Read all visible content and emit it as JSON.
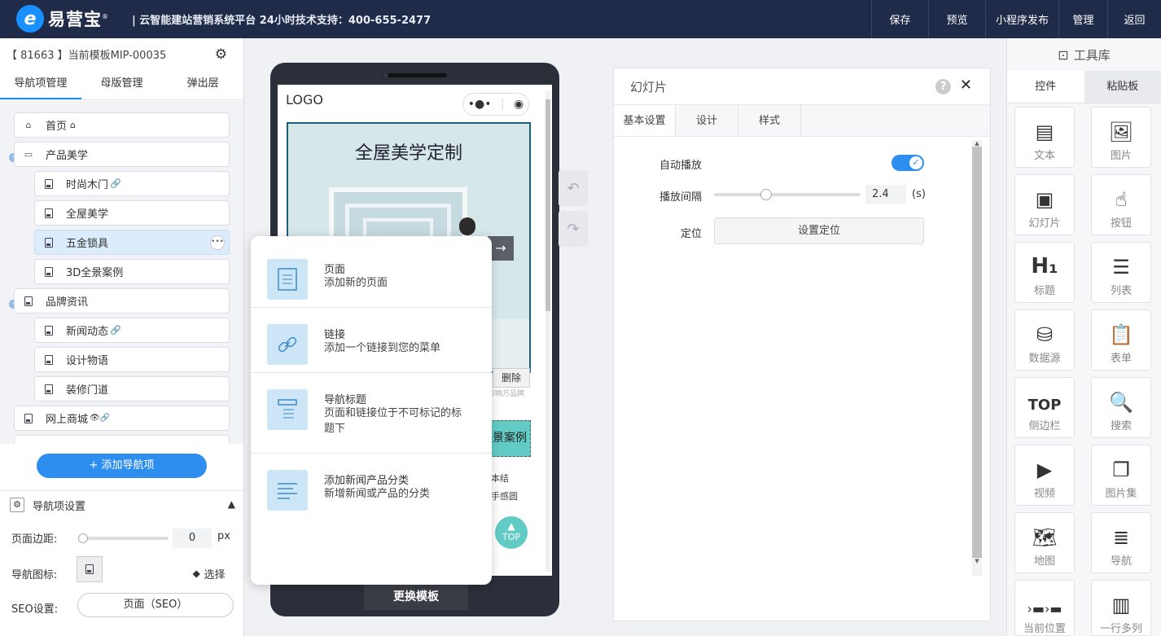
{
  "topbar": {
    "logo_mark": "e",
    "logo_text": "易营宝",
    "logo_reg": "®",
    "slogan": "| 云智能建站营销系统平台 24小时技术支持：400-655-2477",
    "nav": [
      "保存",
      "预览",
      "小程序发布",
      "管理",
      "返回"
    ]
  },
  "left": {
    "template_info": "【 81663 】当前模板MIP-00035",
    "tabs": [
      "导航项管理",
      "母版管理",
      "弹出层"
    ],
    "tree": [
      {
        "label": "首页",
        "suffix": "⌂",
        "level": 0
      },
      {
        "label": "产品美学",
        "suffix": "",
        "level": 0
      },
      {
        "label": "时尚木门",
        "suffix": "🔗",
        "level": 1
      },
      {
        "label": "全屋美学",
        "suffix": "",
        "level": 1
      },
      {
        "label": "五金锁具",
        "suffix": "",
        "level": 1
      },
      {
        "label": "3D全景案例",
        "suffix": "",
        "level": 1
      },
      {
        "label": "品牌资讯",
        "suffix": "",
        "level": 0
      },
      {
        "label": "新闻动态",
        "suffix": "🔗",
        "level": 1
      },
      {
        "label": "设计物语",
        "suffix": "",
        "level": 1
      },
      {
        "label": "装修门道",
        "suffix": "",
        "level": 1
      },
      {
        "label": "网上商城",
        "suffix": "👁🔗",
        "level": 0
      }
    ],
    "add_button": "+ 添加导航项",
    "settings_title": "导航项设置",
    "margin_label": "页面边距:",
    "margin_value": "0",
    "margin_unit": "px",
    "icon_label": "导航图标:",
    "icon_select": "选择",
    "seo_label": "SEO设置:",
    "seo_value": "页面（SEO）"
  },
  "phone": {
    "logo": "LOGO",
    "banner_title": "全屋美学定制",
    "delete": "删除",
    "partial_text": "影响万品牌",
    "case_label": "景案例",
    "side_text_1": "本结",
    "side_text_2": "手感圆",
    "top_button": "TOP",
    "change_template": "更换模板"
  },
  "popup": {
    "items": [
      {
        "title": "页面",
        "desc": "添加新的页面",
        "icon": "page-icon"
      },
      {
        "title": "链接",
        "desc": "添加一个链接到您的菜单",
        "icon": "link-icon"
      },
      {
        "title": "导航标题",
        "desc": "页面和链接位于不可标记的标题下",
        "icon": "nav-title-icon"
      },
      {
        "title": "添加新闻产品分类",
        "desc": "新增新闻或产品的分类",
        "icon": "category-icon"
      }
    ]
  },
  "panel": {
    "title": "幻灯片",
    "tabs": [
      "基本设置",
      "设计",
      "样式"
    ],
    "autoplay_label": "自动播放",
    "autoplay_on": true,
    "interval_label": "播放间隔",
    "interval_value": "2.4",
    "interval_unit": "(s)",
    "position_label": "定位",
    "position_button": "设置定位"
  },
  "toolbox": {
    "title": "工具库",
    "tabs": [
      "控件",
      "粘贴板"
    ],
    "tools": [
      "文本",
      "图片",
      "幻灯片",
      "按钮",
      "标题",
      "列表",
      "数据源",
      "表单",
      "侧边栏",
      "搜索",
      "视频",
      "图片集",
      "地图",
      "导航",
      "当前位置",
      "一行多列"
    ]
  },
  "colors": {
    "topbar": "#1f2b48",
    "accent": "#2d8ef0",
    "selected_row": "#dcecfc"
  }
}
